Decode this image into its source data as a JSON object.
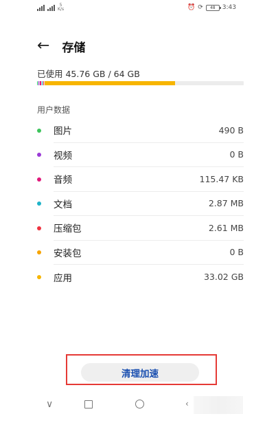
{
  "status_bar": {
    "network_left": "⁴ᴳ",
    "network_mid": "⁴ᴳ",
    "net_speed_value": "5",
    "net_speed_unit": "K/s",
    "battery": "48",
    "time": "3:43"
  },
  "header": {
    "back_label": "←",
    "title": "存储"
  },
  "usage": {
    "text": "已使用 45.76 GB / 64 GB",
    "used_gb": 45.76,
    "total_gb": 64
  },
  "storage_segments": [
    {
      "category": "图片",
      "color": "#2ecc71",
      "fraction": 0.004
    },
    {
      "category": "视频",
      "color": "#9b3ad6",
      "fraction": 0.004
    },
    {
      "category": "音频",
      "color": "#e0197b",
      "fraction": 0.004
    },
    {
      "category": "文档",
      "color": "#1fb3c8",
      "fraction": 0.004
    },
    {
      "category": "压缩包",
      "color": "#ef3340",
      "fraction": 0.004
    },
    {
      "category": "应用",
      "color": "#f7b500",
      "fraction": 0.63
    }
  ],
  "section_title": "用户数据",
  "items": [
    {
      "label": "图片",
      "value": "490 B",
      "color": "#3dc45c"
    },
    {
      "label": "视频",
      "value": "0 B",
      "color": "#9b3ad6"
    },
    {
      "label": "音频",
      "value": "115.47 KB",
      "color": "#e0197b"
    },
    {
      "label": "文档",
      "value": "2.87 MB",
      "color": "#1fb3c8"
    },
    {
      "label": "压缩包",
      "value": "2.61 MB",
      "color": "#ef3340"
    },
    {
      "label": "安装包",
      "value": "0 B",
      "color": "#f7a400"
    },
    {
      "label": "应用",
      "value": "33.02 GB",
      "color": "#f7b500"
    }
  ],
  "clean_button": {
    "label": "清理加速"
  },
  "nav": {
    "back_glyph": "∨",
    "extra_glyph": "‹"
  }
}
